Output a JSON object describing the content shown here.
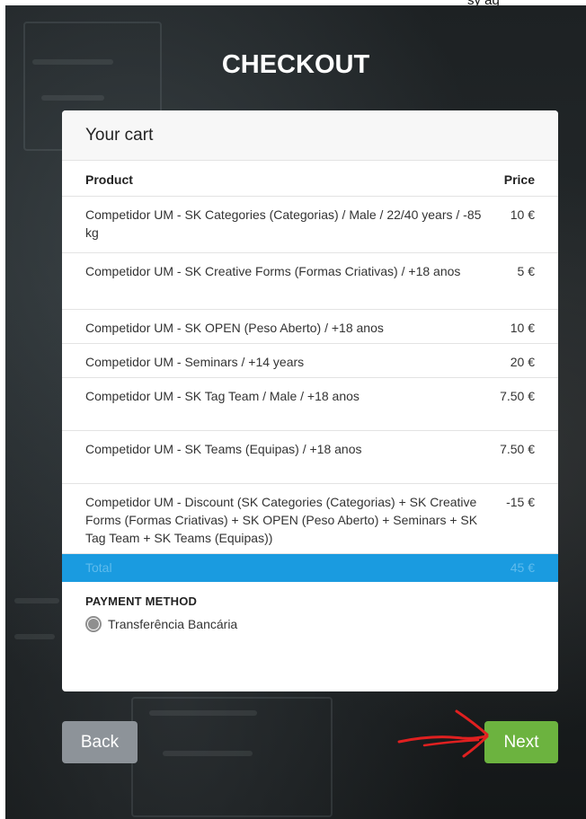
{
  "page": {
    "title": "CHECKOUT",
    "top_partial_text": "sy ag"
  },
  "cart": {
    "header": "Your cart",
    "columns": {
      "product": "Product",
      "price": "Price"
    },
    "items": [
      {
        "product": "Competidor UM - SK Categories (Categorias) / Male / 22/40 years / -85 kg",
        "price": "10 €"
      },
      {
        "product": "Competidor UM - SK Creative Forms (Formas Criativas) / +18 anos",
        "price": "5 €"
      },
      {
        "product": "Competidor UM - SK OPEN (Peso Aberto) / +18 anos",
        "price": "10 €"
      },
      {
        "product": "Competidor UM - Seminars / +14 years",
        "price": "20 €"
      },
      {
        "product": "Competidor UM - SK Tag Team / Male / +18 anos",
        "price": "7.50 €"
      },
      {
        "product": "Competidor UM - SK Teams (Equipas) / +18 anos",
        "price": "7.50 €"
      },
      {
        "product": "Competidor UM - Discount (SK Categories (Categorias) + SK Creative Forms (Formas Criativas) + SK OPEN (Peso Aberto) + Seminars + SK Tag Team + SK Teams (Equipas))",
        "price": "-15 €"
      }
    ],
    "total_label": "Total",
    "total_value": "45 €"
  },
  "payment": {
    "title": "PAYMENT METHOD",
    "option_label": "Transferência Bancária",
    "selected": true
  },
  "buttons": {
    "back": "Back",
    "next": "Next"
  },
  "colors": {
    "total_bar": "#1a9be0",
    "next_button": "#6cb33f",
    "back_button": "#8d9399",
    "annotation_arrow": "#e02020"
  }
}
